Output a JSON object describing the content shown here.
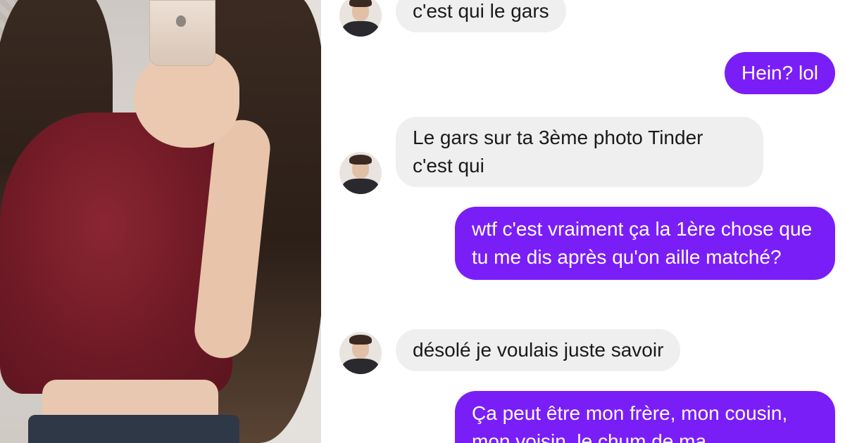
{
  "colors": {
    "outgoing_bubble": "#7a1ef8",
    "incoming_bubble": "#efefef",
    "shirt": "#8b2633"
  },
  "photo": {
    "description_icon": "mirror-selfie-photo"
  },
  "chat": {
    "messages": [
      {
        "from": "them",
        "text": "c'est qui le gars"
      },
      {
        "from": "me",
        "text": "Hein? lol"
      },
      {
        "from": "them",
        "text": "Le gars sur ta 3ème photo Tinder c'est qui"
      },
      {
        "from": "me",
        "text": "wtf c'est vraiment ça la 1ère chose que tu me dis après qu'on aille matché?"
      },
      {
        "from": "them",
        "text": "désolé je voulais juste savoir"
      },
      {
        "from": "me",
        "text": "Ça peut être mon frère, mon cousin, mon voisin, le chum de ma"
      }
    ]
  }
}
